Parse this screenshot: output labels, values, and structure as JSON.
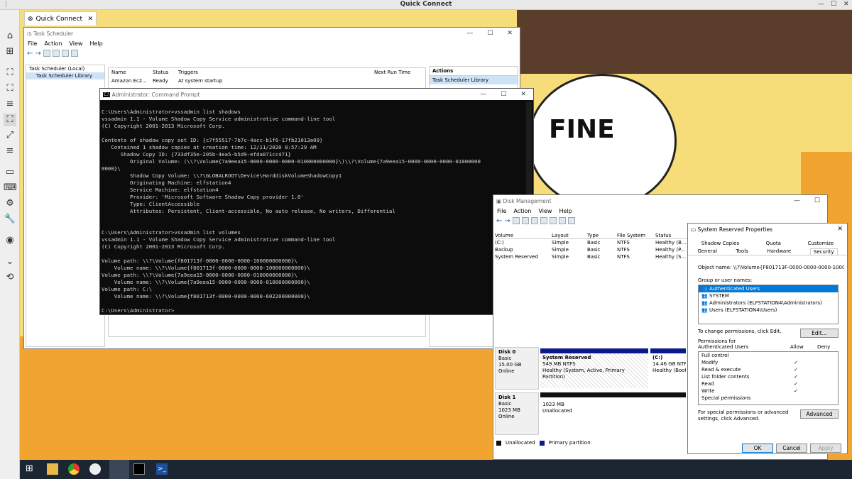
{
  "app": {
    "title": "Quick Connect",
    "tab_label": "Quick Connect"
  },
  "sidebar": {
    "icons": [
      "home-icon",
      "new-tab-icon",
      "fit-screen-icon",
      "fullscreen-icon",
      "scale-icon",
      "expand-icon",
      "menu-icon",
      "display-icon",
      "keyboard-icon",
      "settings-icon",
      "wrench-icon",
      "camera-icon",
      "chevron-down-icon",
      "disconnect-icon"
    ]
  },
  "meme": {
    "text": "FINE"
  },
  "task_scheduler": {
    "title": "Task Scheduler",
    "menu": [
      "File",
      "Action",
      "View",
      "Help"
    ],
    "tree": [
      "Task Scheduler (Local)",
      "Task Scheduler Library"
    ],
    "columns": [
      "Name",
      "Status",
      "Triggers",
      "Next Run Time"
    ],
    "row": [
      "Amazon Ec2...",
      "Ready",
      "At system startup"
    ],
    "actions_header": "Actions",
    "actions_item": "Task Scheduler Library"
  },
  "cmd": {
    "title": "Administrator: Command Prompt",
    "lines": [
      "",
      "C:\\Users\\Administrator>vssadmin list shadows",
      "vssadmin 1.1 - Volume Shadow Copy Service administrative command-line tool",
      "(C) Copyright 2001-2013 Microsoft Corp.",
      "",
      "Contents of shadow copy set ID: {c7f55517-7b7c-4acc-b1f6-17fb21013a09}",
      "   Contained 1 shadow copies at creation time: 12/11/2020 8:57:29 AM",
      "      Shadow Copy ID: {733df35e-205b-4ea5-b5d9-efda071cc471}",
      "         Original Volume: (\\\\?\\Volume{7a9eea15-0000-0000-0000-010000000000}\\)\\\\?\\Volume{7a9eea15-0000-0000-0000-01000000",
      "0000}\\",
      "         Shadow Copy Volume: \\\\?\\GLOBALROOT\\Device\\HarddiskVolumeShadowCopy1",
      "         Originating Machine: elfstation4",
      "         Service Machine: elfstation4",
      "         Provider: 'Microsoft Software Shadow Copy provider 1.0'",
      "         Type: ClientAccessible",
      "         Attributes: Persistent, Client-accessible, No auto release, No writers, Differential",
      "",
      "",
      "C:\\Users\\Administrator>vssadmin list volumes",
      "vssadmin 1.1 - Volume Shadow Copy Service administrative command-line tool",
      "(C) Copyright 2001-2013 Microsoft Corp.",
      "",
      "Volume path: \\\\?\\Volume{f801713f-0000-0000-0000-100000000000}\\",
      "    Volume name: \\\\?\\Volume{f801713f-0000-0000-0000-100000000000}\\",
      "Volume path: \\\\?\\Volume{7a9eea15-0000-0000-0000-010000000000}\\",
      "    Volume name: \\\\?\\Volume{7a9eea15-0000-0000-0000-010000000000}\\",
      "Volume path: C:\\",
      "    Volume name: \\\\?\\Volume{f801713f-0000-0000-0000-602200000000}\\",
      "",
      "C:\\Users\\Administrator>"
    ]
  },
  "disk_mgmt": {
    "title": "Disk Management",
    "menu": [
      "File",
      "Action",
      "View",
      "Help"
    ],
    "columns": [
      "Volume",
      "Layout",
      "Type",
      "File System",
      "Status"
    ],
    "rows": [
      [
        "(C:)",
        "Simple",
        "Basic",
        "NTFS",
        "Healthy (B..."
      ],
      [
        "Backup",
        "Simple",
        "Basic",
        "NTFS",
        "Healthy (P..."
      ],
      [
        "System Reserved",
        "Simple",
        "Basic",
        "NTFS",
        "Healthy (S..."
      ]
    ],
    "disk0": {
      "name": "Disk 0",
      "type": "Basic",
      "size": "15.00 GB",
      "status": "Online",
      "p1_name": "System Reserved",
      "p1_size": "549 MB NTFS",
      "p1_status": "Healthy (System, Active, Primary Partition)",
      "p2_name": "(C:)",
      "p2_size": "14.46 GB NTFS",
      "p2_status": "Healthy (Boot,"
    },
    "disk1": {
      "name": "Disk 1",
      "type": "Basic",
      "size": "1023 MB",
      "status": "Online",
      "p_size": "1023 MB",
      "p_status": "Unallocated"
    },
    "legend": [
      "Unallocated",
      "Primary partition"
    ]
  },
  "props": {
    "title": "System Reserved Properties",
    "tabs_top": [
      "Shadow Copies",
      "Quota",
      "Customize"
    ],
    "tabs_bottom": [
      "General",
      "Tools",
      "Hardware",
      "Security"
    ],
    "object_label": "Object name:",
    "object_value": "\\\\?\\Volume{F801713F-0000-0000-0000-10000000",
    "group_label": "Group or user names:",
    "groups": [
      "Authenticated Users",
      "SYSTEM",
      "Administrators (ELFSTATION4\\Administrators)",
      "Users (ELFSTATION4\\Users)"
    ],
    "change_text": "To change permissions, click Edit.",
    "edit_btn": "Edit...",
    "perm_label": "Permissions for Authenticated Users",
    "allow": "Allow",
    "deny": "Deny",
    "perms": [
      "Full control",
      "Modify",
      "Read & execute",
      "List folder contents",
      "Read",
      "Write",
      "Special permissions"
    ],
    "perm_allow": [
      "",
      "✓",
      "✓",
      "✓",
      "✓",
      "✓",
      ""
    ],
    "special_text": "For special permissions or advanced settings, click Advanced.",
    "advanced_btn": "Advanced",
    "ok": "OK",
    "cancel": "Cancel",
    "apply": "Apply"
  }
}
